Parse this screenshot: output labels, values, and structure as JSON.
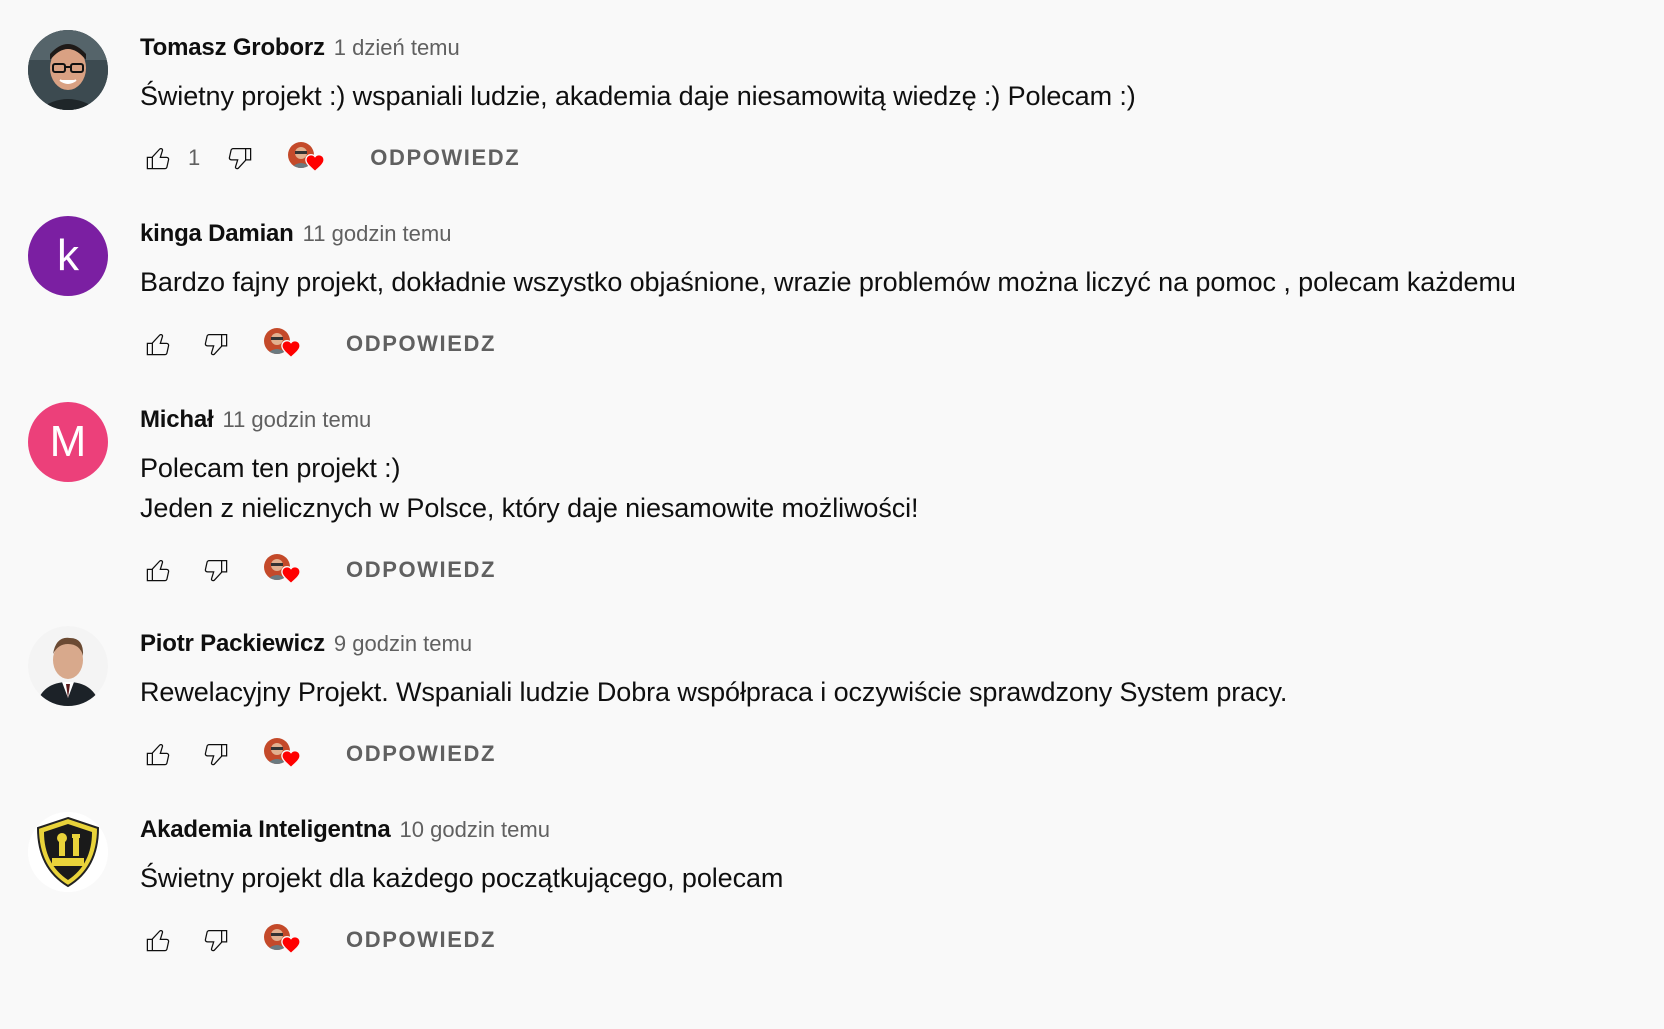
{
  "comments": [
    {
      "author": "Tomasz Groborz",
      "time": "1 dzień temu",
      "text": "Świetny projekt :) wspaniali ludzie, akademia daje niesamowitą wiedzę :) Polecam :)",
      "likes": "1",
      "reply_label": "ODPOWIEDZ",
      "avatar": {
        "type": "photo",
        "icon": "person-glasses-photo"
      }
    },
    {
      "author": "kinga Damian",
      "time": "11 godzin temu",
      "text": "Bardzo fajny projekt, dokładnie wszystko objaśnione, wrazie problemów można liczyć na pomoc , polecam każdemu",
      "likes": "",
      "reply_label": "ODPOWIEDZ",
      "avatar": {
        "type": "letter",
        "letter": "k",
        "color": "#7b1fa2"
      }
    },
    {
      "author": "Michał",
      "time": "11 godzin temu",
      "text": "Polecam ten projekt :)\nJeden z nielicznych w Polsce, który daje niesamowite możliwości!",
      "likes": "",
      "reply_label": "ODPOWIEDZ",
      "avatar": {
        "type": "letter",
        "letter": "M",
        "color": "#ec407a"
      }
    },
    {
      "author": "Piotr Packiewicz",
      "time": "9 godzin temu",
      "text": "Rewelacyjny Projekt. Wspaniali ludzie Dobra współpraca i oczywiście sprawdzony System pracy.",
      "likes": "",
      "reply_label": "ODPOWIEDZ",
      "avatar": {
        "type": "photo",
        "icon": "person-suit-photo"
      }
    },
    {
      "author": "Akademia Inteligentna",
      "time": "10 godzin temu",
      "text": "Świetny projekt dla każdego początkującego, polecam",
      "likes": "",
      "reply_label": "ODPOWIEDZ",
      "avatar": {
        "type": "logo",
        "icon": "chess-shield-logo"
      }
    }
  ],
  "colors": {
    "background": "#f9f9f9",
    "text_primary": "#0f0f0f",
    "text_secondary": "#606060",
    "heart": "#ff0000"
  },
  "icons": {
    "like": "thumb-up-icon",
    "dislike": "thumb-down-icon",
    "creator_heart": "creator-heart-icon"
  }
}
